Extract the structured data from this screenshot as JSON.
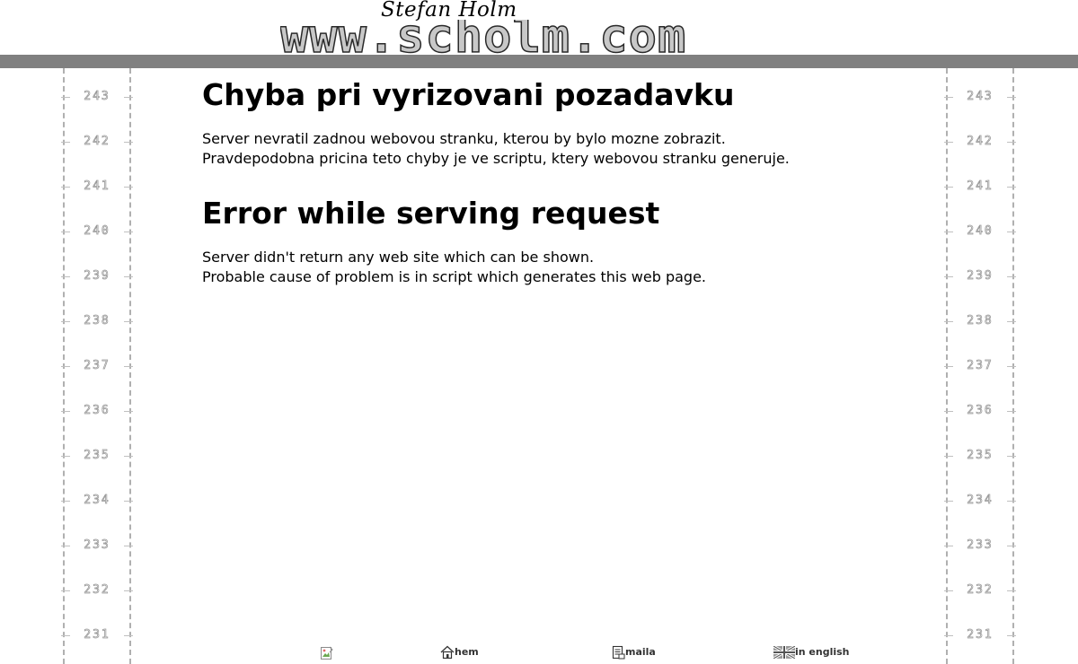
{
  "header": {
    "logo_script": "Stefan Holm",
    "logo_text": "www.scholm.com"
  },
  "rulers": {
    "numbers": [
      "243",
      "242",
      "241",
      "240",
      "239",
      "238",
      "237",
      "236",
      "235",
      "234",
      "233",
      "232",
      "231"
    ]
  },
  "content": {
    "cz_heading": "Chyba pri vyrizovani pozadavku",
    "cz_line1": "Server nevratil zadnou webovou stranku, kterou by bylo mozne zobrazit.",
    "cz_line2": "Pravdepodobna pricina teto chyby je ve scriptu, ktery webovou stranku generuje.",
    "en_heading": "Error while serving request",
    "en_line1": "Server didn't return any web site which can be shown.",
    "en_line2": "Probable cause of problem is in script which generates this web page."
  },
  "footer": {
    "home_label": "hem",
    "mail_label": "maila",
    "english_label": "in english",
    "home_icon": "house-icon",
    "mail_icon": "document-icon",
    "english_icon": "uk-flag-icon"
  }
}
